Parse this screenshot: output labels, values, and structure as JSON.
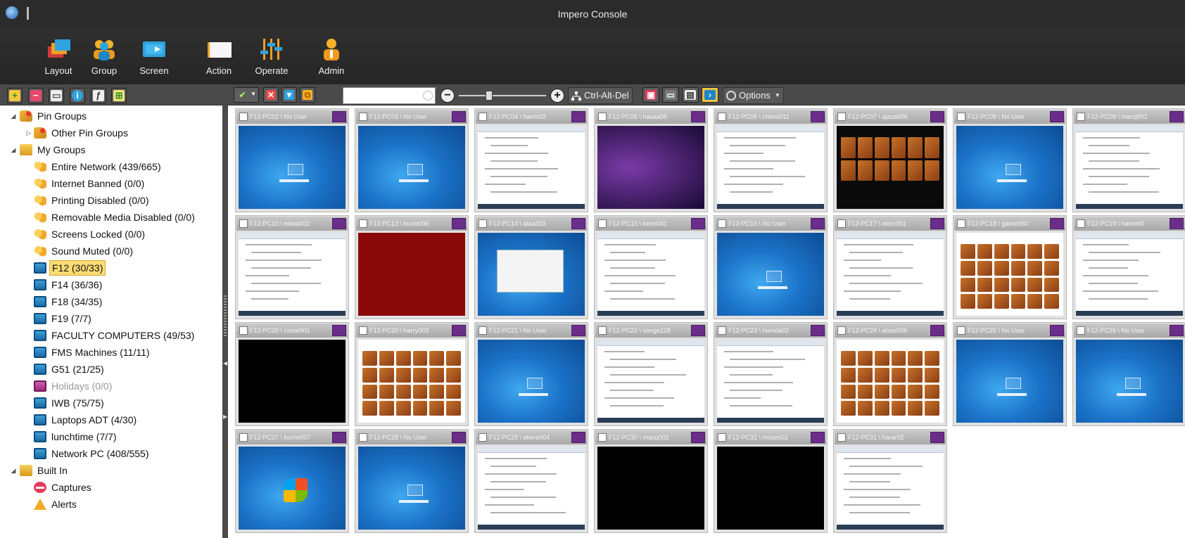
{
  "window": {
    "title": "Impero Console"
  },
  "ribbon": [
    {
      "label": "Layout",
      "icon": "layout-icon"
    },
    {
      "label": "Group",
      "icon": "group-icon"
    },
    {
      "label": "Screen",
      "icon": "screen-icon"
    },
    {
      "label": "Action",
      "icon": "action-icon"
    },
    {
      "label": "Operate",
      "icon": "operate-icon"
    },
    {
      "label": "Admin",
      "icon": "admin-icon"
    }
  ],
  "tree": [
    {
      "label": "Pin Groups",
      "level": 0,
      "icon": "pin",
      "expanded": true
    },
    {
      "label": "Other Pin Groups",
      "level": 1,
      "icon": "pin",
      "expanded": false
    },
    {
      "label": "My Groups",
      "level": 0,
      "icon": "folder",
      "expanded": true
    },
    {
      "label": "Entire Network (439/665)",
      "level": 1,
      "icon": "grp"
    },
    {
      "label": "Internet Banned (0/0)",
      "level": 1,
      "icon": "grp"
    },
    {
      "label": "Printing Disabled (0/0)",
      "level": 1,
      "icon": "grp"
    },
    {
      "label": "Removable Media Disabled (0/0)",
      "level": 1,
      "icon": "grp"
    },
    {
      "label": "Screens Locked (0/0)",
      "level": 1,
      "icon": "grp"
    },
    {
      "label": "Sound Muted (0/0)",
      "level": 1,
      "icon": "grp"
    },
    {
      "label": "F12 (30/33)",
      "level": 1,
      "icon": "mon",
      "selected": true
    },
    {
      "label": "F14 (36/36)",
      "level": 1,
      "icon": "mon"
    },
    {
      "label": "F18 (34/35)",
      "level": 1,
      "icon": "mon"
    },
    {
      "label": "F19 (7/7)",
      "level": 1,
      "icon": "mon"
    },
    {
      "label": "FACULTY COMPUTERS (49/53)",
      "level": 1,
      "icon": "mon"
    },
    {
      "label": "FMS Machines (11/11)",
      "level": 1,
      "icon": "mon"
    },
    {
      "label": "G51 (21/25)",
      "level": 1,
      "icon": "mon"
    },
    {
      "label": "Holidays (0/0)",
      "level": 1,
      "icon": "monp",
      "disabled": true
    },
    {
      "label": "IWB (75/75)",
      "level": 1,
      "icon": "mon"
    },
    {
      "label": "Laptops ADT (4/30)",
      "level": 1,
      "icon": "mon"
    },
    {
      "label": "lunchtime (7/7)",
      "level": 1,
      "icon": "mon"
    },
    {
      "label": "Network PC (408/555)",
      "level": 1,
      "icon": "mon"
    },
    {
      "label": "Built In",
      "level": 0,
      "icon": "folder",
      "expanded": true
    },
    {
      "label": "Captures",
      "level": 1,
      "icon": "cap"
    },
    {
      "label": "Alerts",
      "level": 1,
      "icon": "alert"
    }
  ],
  "toolbar": {
    "ctrl_alt_del": "Ctrl-Alt-Del",
    "options": "Options",
    "search_value": ""
  },
  "computers": [
    {
      "name": "F12-PC02 \\ No User",
      "screen": "desk"
    },
    {
      "name": "F12-PC03 \\ No User",
      "screen": "desk"
    },
    {
      "name": "F12-PC04 \\ harris02",
      "screen": "doc"
    },
    {
      "name": "F12-PC05 \\ hasaa06",
      "screen": "purple"
    },
    {
      "name": "F12-PC06 \\ chens011",
      "screen": "doc"
    },
    {
      "name": "F12-PC07 \\ ajaza006",
      "screen": "dark"
    },
    {
      "name": "F12-PC08 \\ No User",
      "screen": "desk"
    },
    {
      "name": "F12-PC09 \\ macq001",
      "screen": "web"
    },
    {
      "name": "F12-PC10 \\ edwa002",
      "screen": "web"
    },
    {
      "name": "F12-PC13 \\ burre006",
      "screen": "red"
    },
    {
      "name": "F12-PC14 \\ alaa333",
      "screen": "deskwin"
    },
    {
      "name": "F12-PC15 \\ kenn041",
      "screen": "web"
    },
    {
      "name": "F12-PC16 \\ No User",
      "screen": "desk"
    },
    {
      "name": "F12-PC17 \\ elerc001",
      "screen": "web"
    },
    {
      "name": "F12-PC18 \\ garse060",
      "screen": "food"
    },
    {
      "name": "F12-PC19 \\ hammi0",
      "screen": "web"
    },
    {
      "name": "F12-PC20 \\ rosse001",
      "screen": "black"
    },
    {
      "name": "F12-PC20 \\ harry003",
      "screen": "food"
    },
    {
      "name": "F12-PC21 \\ No User",
      "screen": "desk"
    },
    {
      "name": "F12-PC22 \\ songe128",
      "screen": "web"
    },
    {
      "name": "F12-PC23 \\ hamda02",
      "screen": "web"
    },
    {
      "name": "F12-PC24 \\ alsse006",
      "screen": "food"
    },
    {
      "name": "F12-PC25 \\ No User",
      "screen": "desk"
    },
    {
      "name": "F12-PC26 \\ No User",
      "screen": "desk"
    },
    {
      "name": "F12-PC27 \\ burne007",
      "screen": "desklogo"
    },
    {
      "name": "F12-PC28 \\ No User",
      "screen": "desk"
    },
    {
      "name": "F12-PC29 \\ ekere004",
      "screen": "doc"
    },
    {
      "name": "F12-PC30 \\ macq002",
      "screen": "black"
    },
    {
      "name": "F12-PC31 \\ moses02",
      "screen": "black"
    },
    {
      "name": "F12-PC31 \\ harar02",
      "screen": "doc"
    }
  ],
  "colors": {
    "selected_group": "#fbdc73",
    "user_badge": "#6b2d8a",
    "chrome_dark": "#2b2b2b"
  }
}
